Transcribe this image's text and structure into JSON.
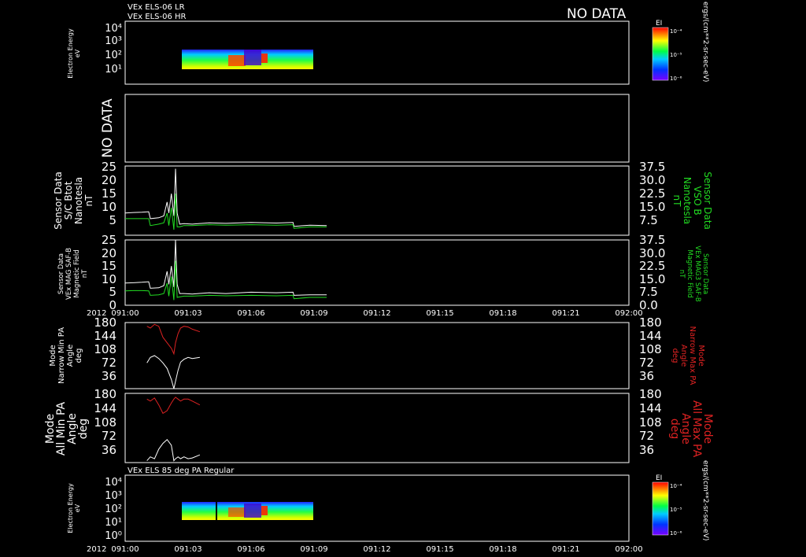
{
  "header": {
    "line1": "VEx ELS-06 LR",
    "line2": "VEx ELS-06 HR",
    "no_data": "NO DATA"
  },
  "colorbar_units": "ergs/(cm**2-sr-sec-eV)",
  "colorbar_label": "EI",
  "colorbar_ticks": [
    "10⁻⁴",
    "10⁻⁵",
    "10⁻⁶"
  ],
  "panels": [
    {
      "id": "spec1",
      "left_label": [
        "Electron Energy",
        "eV"
      ],
      "yticks": [
        "10⁴",
        "10³",
        "10²",
        "10¹"
      ]
    },
    {
      "id": "nodata",
      "left_label": [
        "NO DATA"
      ]
    },
    {
      "id": "mag1",
      "left_label": [
        "Sensor Data",
        "S/C Btot",
        "Nanotesla",
        "nT"
      ],
      "right_label": [
        "Sensor Data",
        "VSO B",
        "Nanotesla",
        "nT"
      ],
      "yticks": [
        "25",
        "20",
        "15",
        "10",
        "5"
      ],
      "yticks_right": [
        "37.5",
        "30.0",
        "22.5",
        "15.0",
        "7.5"
      ]
    },
    {
      "id": "mag2",
      "left_label": [
        "Sensor Data",
        "VEx MAG SAF-B",
        "Magnetic Field",
        "nT"
      ],
      "right_label": [
        "Sensor Data",
        "VEx MAG3 SAF-B",
        "Magnetic Field",
        "nT"
      ],
      "yticks": [
        "25",
        "20",
        "15",
        "10",
        "5",
        "0"
      ],
      "yticks_right": [
        "37.5",
        "30.0",
        "22.5",
        "15.0",
        "7.5",
        "0.0"
      ]
    },
    {
      "id": "pa1",
      "left_label": [
        "Mode",
        "Narrow Min PA",
        "Angle",
        "deg"
      ],
      "right_label": [
        "Mode",
        "Narrow Max PA",
        "Angle",
        "deg"
      ],
      "yticks": [
        "180",
        "144",
        "108",
        "72",
        "36"
      ],
      "yticks_right": [
        "180",
        "144",
        "108",
        "72",
        "36"
      ]
    },
    {
      "id": "pa2",
      "left_label": [
        "Mode",
        "All Min PA",
        "Angle",
        "deg"
      ],
      "right_label": [
        "Mode",
        "All Max PA",
        "Angle",
        "deg"
      ],
      "yticks": [
        "180",
        "144",
        "108",
        "72",
        "36"
      ],
      "yticks_right": [
        "180",
        "144",
        "108",
        "72",
        "36"
      ]
    },
    {
      "id": "spec2",
      "title": "VEx ELS 85 deg PA Regular",
      "left_label": [
        "Electron Energy",
        "eV"
      ],
      "yticks": [
        "10⁴",
        "10³",
        "10²",
        "10¹",
        "10⁰"
      ]
    }
  ],
  "xaxis": {
    "year": "2012",
    "ticks": [
      "091:00",
      "091:03",
      "091:06",
      "091:09",
      "091:12",
      "091:15",
      "091:18",
      "091:21",
      "092:00"
    ]
  },
  "colors": {
    "white": "#ffffff",
    "green": "#22dd22",
    "red": "#dd2222",
    "frame": "#ffffff"
  },
  "chart_data": [
    {
      "type": "heatmap",
      "title": "",
      "xlabel": "",
      "ylabel": "Electron Energy eV",
      "xlim": [
        "091:00",
        "092:00"
      ],
      "ylim": [
        1,
        10000
      ],
      "log_y": true,
      "data_extent_x": [
        "091:02.6",
        "091:08.9"
      ],
      "data_extent_y": [
        6,
        200
      ]
    },
    {
      "type": "line",
      "title": "",
      "ylabel": "S/C Btot nT",
      "ylabel_right": "VSO B nT",
      "x_minutes": [
        0,
        1,
        2,
        2.8,
        3,
        4,
        4.6,
        5.0,
        5.2,
        5.5,
        5.8,
        6.0,
        6.2,
        6.5,
        7,
        8,
        10,
        12,
        15,
        18,
        20,
        20.1,
        22,
        24
      ],
      "series": [
        {
          "color": "#ffffff",
          "values": [
            8,
            8.2,
            8.3,
            8.5,
            6,
            6.3,
            7,
            12,
            8,
            15,
            7,
            24,
            8,
            4,
            4.2,
            4,
            4.5,
            4.3,
            4.6,
            4.4,
            4.6,
            3.2,
            3.6,
            3.5
          ]
        },
        {
          "color": "#22dd22",
          "values": [
            6,
            6,
            6,
            6,
            3.5,
            4,
            4.5,
            8,
            3.5,
            10,
            2,
            15,
            3,
            3,
            3.5,
            3.5,
            3.8,
            3.6,
            3.8,
            3.6,
            3.8,
            2.5,
            3,
            3
          ]
        }
      ],
      "ylim": [
        0,
        25
      ]
    },
    {
      "type": "line",
      "title": "",
      "ylabel": "VEx MAG SAF-B nT",
      "ylabel_right": "VEx MAG3 SAF-B nT",
      "x_minutes": [
        0,
        1,
        2,
        2.8,
        3,
        4,
        4.6,
        5.0,
        5.2,
        5.5,
        5.8,
        6.0,
        6.2,
        6.5,
        7,
        8,
        10,
        12,
        15,
        18,
        20,
        20.1,
        22,
        24
      ],
      "series": [
        {
          "color": "#ffffff",
          "values": [
            8.5,
            8.6,
            8.8,
            9,
            6.5,
            6.7,
            7.5,
            13,
            8,
            15,
            7,
            25,
            8,
            4.5,
            4.5,
            4.3,
            4.8,
            4.5,
            5,
            4.8,
            5,
            3.8,
            4,
            4
          ]
        },
        {
          "color": "#22dd22",
          "values": [
            5.5,
            5.6,
            5.6,
            5.5,
            3.8,
            4,
            4.5,
            8.5,
            3.5,
            11,
            2,
            17,
            3,
            3.2,
            3.5,
            3.5,
            3.8,
            3.6,
            3.8,
            3.6,
            3.8,
            2.5,
            3,
            3
          ]
        }
      ],
      "ylim": [
        0,
        25
      ]
    },
    {
      "type": "line",
      "title": "",
      "ylabel": "Narrow Min PA deg",
      "ylabel_right": "Narrow Max PA deg",
      "x_minutes": [
        2.6,
        3,
        3.5,
        4,
        4.5,
        5,
        5.5,
        5.8,
        6,
        6.3,
        6.6,
        7,
        7.5,
        8,
        8.9
      ],
      "series": [
        {
          "color": "#ffffff",
          "values": [
            70,
            85,
            90,
            82,
            70,
            55,
            25,
            0,
            20,
            50,
            72,
            80,
            85,
            82,
            85
          ]
        },
        {
          "color": "#dd2222",
          "values": [
            170,
            165,
            175,
            170,
            140,
            125,
            110,
            95,
            125,
            150,
            165,
            170,
            168,
            162,
            155
          ]
        }
      ],
      "ylim": [
        0,
        180
      ]
    },
    {
      "type": "line",
      "title": "",
      "ylabel": "All Min PA deg",
      "ylabel_right": "All Max PA deg",
      "x_minutes": [
        2.6,
        3,
        3.5,
        4,
        4.5,
        5,
        5.5,
        5.8,
        6,
        6.3,
        6.6,
        7,
        7.5,
        8,
        8.9
      ],
      "series": [
        {
          "color": "#ffffff",
          "values": [
            5,
            15,
            10,
            35,
            50,
            60,
            45,
            5,
            10,
            15,
            10,
            15,
            10,
            12,
            20
          ]
        },
        {
          "color": "#dd2222",
          "values": [
            165,
            160,
            168,
            150,
            128,
            135,
            155,
            165,
            170,
            165,
            160,
            165,
            165,
            160,
            150
          ]
        }
      ],
      "ylim": [
        0,
        180
      ]
    },
    {
      "type": "heatmap",
      "title": "VEx ELS 85 deg PA Regular",
      "ylabel": "Electron Energy eV",
      "xlim": [
        "091:00",
        "092:00"
      ],
      "ylim": [
        1,
        10000
      ],
      "log_y": true,
      "data_extent_x": [
        "091:02.6",
        "091:08.9"
      ],
      "data_extent_y": [
        4,
        200
      ]
    }
  ]
}
